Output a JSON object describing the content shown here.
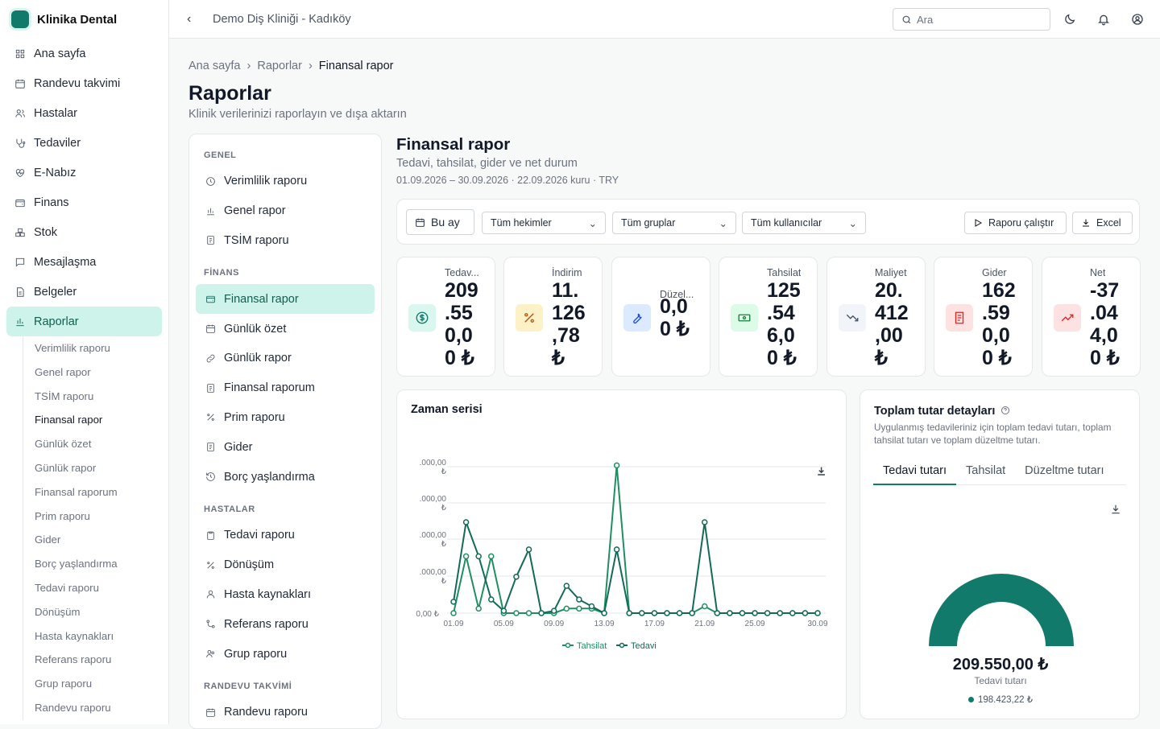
{
  "app": {
    "name": "Klinika Dental",
    "clinic": "Demo Diş Kliniği - Kadıköy",
    "search_placeholder": "Ara"
  },
  "sidebar": {
    "items": [
      {
        "label": "Ana sayfa",
        "icon": "grid-icon"
      },
      {
        "label": "Randevu takvimi",
        "icon": "calendar-icon"
      },
      {
        "label": "Hastalar",
        "icon": "users-icon"
      },
      {
        "label": "Tedaviler",
        "icon": "stethoscope-icon"
      },
      {
        "label": "E-Nabız",
        "icon": "heart-pulse-icon"
      },
      {
        "label": "Finans",
        "icon": "wallet-icon"
      },
      {
        "label": "Stok",
        "icon": "boxes-icon"
      },
      {
        "label": "Mesajlaşma",
        "icon": "message-icon"
      },
      {
        "label": "Belgeler",
        "icon": "document-icon"
      },
      {
        "label": "Raporlar",
        "icon": "bar-chart-icon"
      }
    ],
    "sub_items": [
      "Verimlilik raporu",
      "Genel rapor",
      "TSİM raporu",
      "Finansal rapor",
      "Günlük özet",
      "Günlük rapor",
      "Finansal raporum",
      "Prim raporu",
      "Gider",
      "Borç yaşlandırma",
      "Tedavi raporu",
      "Dönüşüm",
      "Hasta kaynakları",
      "Referans raporu",
      "Grup raporu",
      "Randevu raporu"
    ]
  },
  "breadcrumb": [
    "Ana sayfa",
    "Raporlar",
    "Finansal rapor"
  ],
  "page": {
    "title": "Raporlar",
    "subtitle": "Klinik verilerinizi raporlayın ve dışa aktarın"
  },
  "report_menu": {
    "sections": [
      {
        "title": "GENEL",
        "items": [
          "Verimlilik raporu",
          "Genel rapor",
          "TSİM raporu"
        ]
      },
      {
        "title": "FİNANS",
        "items": [
          "Finansal rapor",
          "Günlük özet",
          "Günlük rapor",
          "Finansal raporum",
          "Prim raporu",
          "Gider",
          "Borç yaşlandırma"
        ]
      },
      {
        "title": "HASTALAR",
        "items": [
          "Tedavi raporu",
          "Dönüşüm",
          "Hasta kaynakları",
          "Referans raporu",
          "Grup raporu"
        ]
      },
      {
        "title": "RANDEVU TAKVİMİ",
        "items": [
          "Randevu raporu"
        ]
      }
    ]
  },
  "report": {
    "title": "Finansal rapor",
    "subtitle": "Tedavi, tahsilat, gider ve net durum",
    "range": "01.09.2026 – 30.09.2026 · 22.09.2026 kuru · TRY"
  },
  "filters": {
    "period": "Bu ay",
    "doctors": "Tüm hekimler",
    "groups": "Tüm gruplar",
    "users": "Tüm kullanıcılar",
    "run": "Raporu çalıştır",
    "excel": "Excel"
  },
  "kpis": [
    {
      "label": "Tedavi tutarı",
      "label_shown": "Tedav...",
      "value": "209.550,00 ₺",
      "icon": "dollar-icon",
      "bg": "#d9f7ef",
      "fg": "#127a6a"
    },
    {
      "label": "İndirim",
      "label_shown": "İndirim",
      "value": "11.126,78 ₺",
      "icon": "percent-icon",
      "bg": "#fdf1c7",
      "fg": "#b45309"
    },
    {
      "label": "Düzeltme",
      "label_shown": "Düzel...",
      "value": "0,00 ₺",
      "icon": "wrench-icon",
      "bg": "#dbeafe",
      "fg": "#1d4ed8"
    },
    {
      "label": "Tahsilat",
      "label_shown": "Tahsilat",
      "value": "125.546,00 ₺",
      "icon": "cash-icon",
      "bg": "#dcfce7",
      "fg": "#15803d"
    },
    {
      "label": "Maliyet",
      "label_shown": "Maliyet",
      "value": "20.412,00 ₺",
      "icon": "trend-down-icon",
      "bg": "#f1f5f9",
      "fg": "#475569"
    },
    {
      "label": "Gider",
      "label_shown": "Gider",
      "value": "162.590,00 ₺",
      "icon": "receipt-icon",
      "bg": "#fee2e2",
      "fg": "#dc2626"
    },
    {
      "label": "Net",
      "label_shown": "Net",
      "value": "-37.044,00 ₺",
      "icon": "trend-up-icon",
      "bg": "#fee2e2",
      "fg": "#dc2626"
    }
  ],
  "kpi_values_shown": [
    [
      "209",
      ".55",
      "0,0",
      "0 ₺"
    ],
    [
      "11.",
      "126",
      ",78",
      "₺"
    ],
    [
      "0,0",
      "0 ₺"
    ],
    [
      "125",
      ".54",
      "6,0",
      "0 ₺"
    ],
    [
      "20.",
      "412",
      ",00",
      "₺"
    ],
    [
      "162",
      ".59",
      "0,0",
      "0 ₺"
    ],
    [
      "-37",
      ".04",
      "4,0",
      "0 ₺"
    ]
  ],
  "chart_data": {
    "type": "line",
    "title": "Zaman serisi",
    "x": [
      "01.09",
      "02.09",
      "03.09",
      "04.09",
      "05.09",
      "06.09",
      "07.09",
      "08.09",
      "09.09",
      "10.09",
      "11.09",
      "12.09",
      "13.09",
      "14.09",
      "15.09",
      "16.09",
      "17.09",
      "18.09",
      "19.09",
      "20.09",
      "21.09",
      "22.09",
      "23.09",
      "24.09",
      "25.09",
      "26.09",
      "27.09",
      "28.09",
      "29.09",
      "30.09"
    ],
    "x_tick_labels": [
      "01.09",
      "05.09",
      "09.09",
      "13.09",
      "17.09",
      "21.09",
      "25.09",
      "30.09"
    ],
    "y_tick_labels": [
      "0,00 ₺",
      ".000,00 ₺",
      ".000,00 ₺",
      ".000,00 ₺",
      ".000,00 ₺"
    ],
    "ylim": [
      0,
      4
    ],
    "series": [
      {
        "name": "Tahsilat",
        "values": [
          0,
          1.25,
          0.1,
          1.25,
          0,
          0,
          0,
          0,
          0,
          0.1,
          0.1,
          0.1,
          0,
          3.25,
          0,
          0,
          0,
          0,
          0,
          0,
          0.15,
          0,
          0,
          0,
          0,
          0,
          0,
          0,
          0,
          0
        ]
      },
      {
        "name": "Tedavi",
        "values": [
          0.25,
          2.0,
          1.25,
          0.3,
          0.05,
          0.8,
          1.4,
          0,
          0.05,
          0.6,
          0.3,
          0.15,
          0,
          1.4,
          0,
          0,
          0,
          0,
          0,
          0,
          2.0,
          0,
          0,
          0,
          0,
          0,
          0,
          0,
          0,
          0
        ]
      }
    ],
    "grid": true,
    "legend": "bottom"
  },
  "details": {
    "title": "Toplam tutar detayları",
    "desc": "Uygulanmış tedavileriniz için toplam tedavi tutarı, toplam tahsilat tutarı ve toplam düzeltme tutarı.",
    "tabs": [
      "Tedavi tutarı",
      "Tahsilat",
      "Düzeltme tutarı"
    ],
    "total": "209.550,00 ₺",
    "total_label": "Tedavi tutarı",
    "legend_value": "198.423,22 ₺",
    "gauge_fraction": 1.0,
    "accent": "#127a6a"
  }
}
